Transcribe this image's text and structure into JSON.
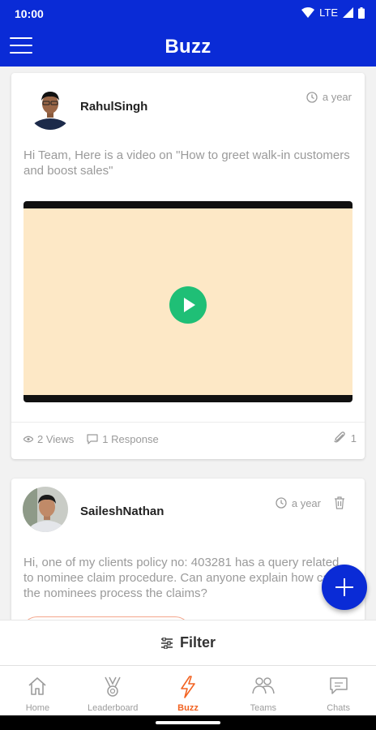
{
  "status_bar": {
    "time": "10:00",
    "network": "LTE"
  },
  "app_bar": {
    "title": "Buzz"
  },
  "posts": [
    {
      "author": "RahulSingh",
      "time_ago": "a year",
      "text": "Hi Team, Here is a video on \"How to greet walk-in customers and boost sales\"",
      "views": "2 Views",
      "responses": "1 Response",
      "attachments": "1"
    },
    {
      "author": "SaileshNathan",
      "time_ago": "a year",
      "text": "Hi, one of my clients policy no: 403281 has a query related to nominee claim procedure. Can anyone explain how can the nominees process the claims?"
    }
  ],
  "filter": {
    "label": "Filter"
  },
  "bottom_nav": [
    {
      "label": "Home",
      "icon": "home-icon",
      "active": false
    },
    {
      "label": "Leaderboard",
      "icon": "trophy-icon",
      "active": false
    },
    {
      "label": "Buzz",
      "icon": "bolt-icon",
      "active": true
    },
    {
      "label": "Teams",
      "icon": "team-icon",
      "active": false
    },
    {
      "label": "Chats",
      "icon": "chat-icon",
      "active": false
    }
  ],
  "colors": {
    "primary": "#0a2bd6",
    "accent": "#f26322",
    "play": "#1fbf76",
    "video_bg": "#fde8c6"
  }
}
